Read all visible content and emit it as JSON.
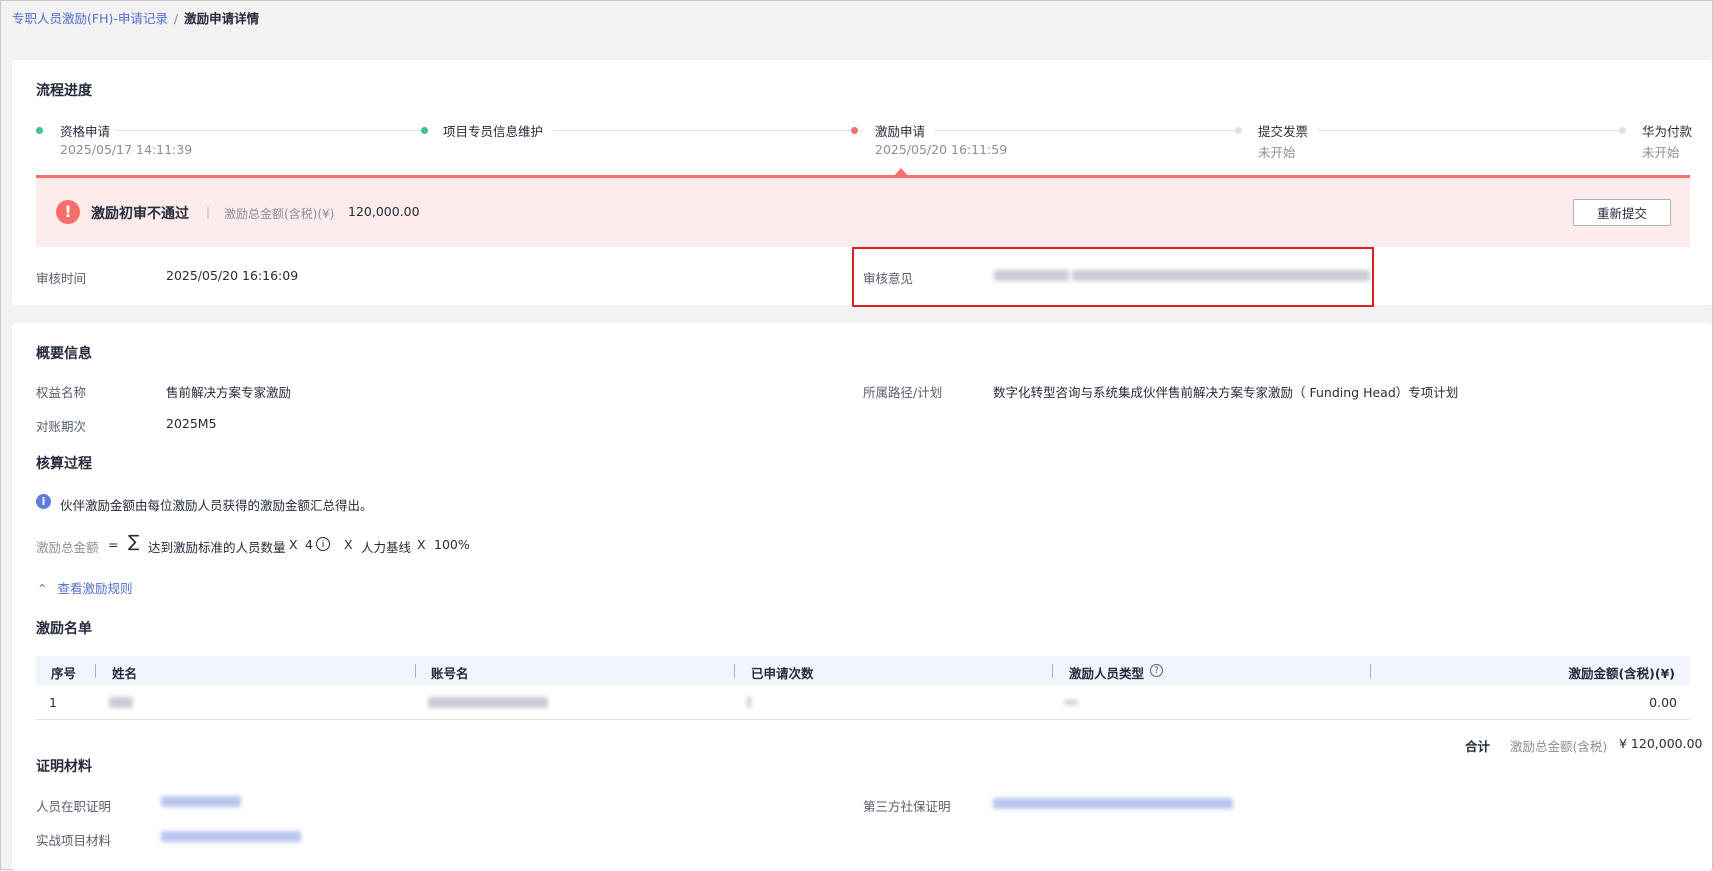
{
  "breadcrumb": {
    "parent": "专职人员激励(FH)-申请记录",
    "separator": "/",
    "current": "激励申请详情"
  },
  "progress": {
    "title": "流程进度",
    "steps": [
      {
        "label": "资格申请",
        "time": "2025/05/17 14:11:39",
        "status": "done"
      },
      {
        "label": "项目专员信息维护",
        "time": "",
        "status": "done"
      },
      {
        "label": "激励申请",
        "time": "2025/05/20 16:11:59",
        "status": "current"
      },
      {
        "label": "提交发票",
        "time": "未开始",
        "status": "pending"
      },
      {
        "label": "华为付款",
        "time": "未开始",
        "status": "pending"
      }
    ]
  },
  "alert": {
    "icon": "exclamation-icon",
    "title": "激励初审不通过",
    "divider": "|",
    "amount_label": "激励总金额(含税)(¥)",
    "amount": "120,000.00",
    "resubmit_label": "重新提交"
  },
  "review": {
    "time_label": "审核时间",
    "time_value": "2025/05/20 16:16:09",
    "opinion_label": "审核意见"
  },
  "summary": {
    "title": "概要信息",
    "benefit_label": "权益名称",
    "benefit_value": "售前解决方案专家激励",
    "plan_label": "所属路径/计划",
    "plan_value": "数字化转型咨询与系统集成伙伴售前解决方案专家激励（ Funding Head）专项计划",
    "period_label": "对账期次",
    "period_value": "2025M5"
  },
  "calculation": {
    "title": "核算过程",
    "info_text": "伙伴激励金额由每位激励人员获得的激励金额汇总得出。",
    "formula": {
      "label": "激励总金额",
      "equals": "=",
      "sigma": "∑",
      "term1": "达到激励标准的人员数量",
      "times": "X",
      "factor": "4",
      "term2": "人力基线",
      "term3": "100%"
    },
    "rule_link": "查看激励规则"
  },
  "incentive_list": {
    "title": "激励名单",
    "columns": [
      "序号",
      "姓名",
      "账号名",
      "已申请次数",
      "激励人员类型",
      "激励金额(含税)(¥)"
    ],
    "rows": [
      {
        "index": "1",
        "amount": "0.00"
      }
    ],
    "total_label": "合计",
    "total_amount_label": "激励总金额(含税)",
    "total_amount": "¥ 120,000.00"
  },
  "materials": {
    "title": "证明材料",
    "employment_label": "人员在职证明",
    "social_security_label": "第三方社保证明",
    "project_label": "实战项目材料"
  },
  "colors": {
    "accent_blue": "#526ecc",
    "success_green": "#3ac295",
    "error_red": "#f66f6a",
    "highlight_red": "#e02020"
  }
}
